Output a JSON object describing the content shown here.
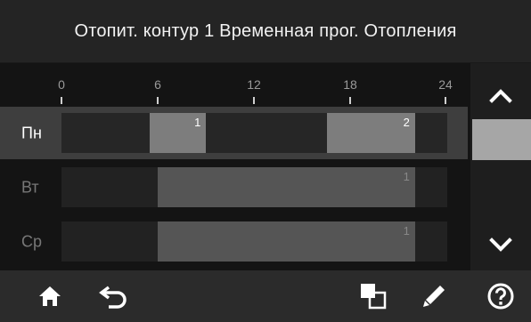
{
  "header": {
    "title": "Отопит. контур 1 Временная прог. Отопления"
  },
  "scale": {
    "ticks": [
      "0",
      "6",
      "12",
      "18",
      "24"
    ]
  },
  "schedule": {
    "days": [
      {
        "label": "Пн",
        "active": true,
        "segments": [
          {
            "label": "1",
            "start": 5.5,
            "end": 9.0
          },
          {
            "label": "2",
            "start": 16.5,
            "end": 22.0
          }
        ]
      },
      {
        "label": "Вт",
        "active": false,
        "segments": [
          {
            "label": "1",
            "start": 6.0,
            "end": 22.0
          }
        ]
      },
      {
        "label": "Ср",
        "active": false,
        "segments": [
          {
            "label": "1",
            "start": 6.0,
            "end": 22.0
          }
        ]
      }
    ]
  },
  "sidebar": {
    "up_icon": "chevron-up-icon",
    "down_icon": "chevron-down-icon"
  },
  "footer": {
    "buttons": [
      "home-icon",
      "back-icon",
      "copy-icon",
      "edit-icon",
      "help-icon"
    ]
  },
  "colors": {
    "accent": "#ffffff",
    "active_row": "#3e3e3e",
    "segment_active": "#7d7d7d",
    "segment_inactive": "#555555"
  }
}
